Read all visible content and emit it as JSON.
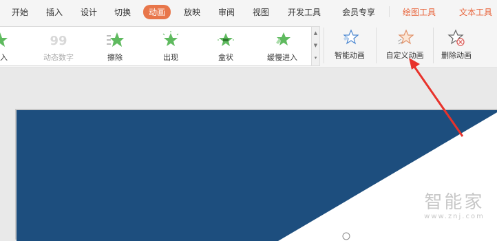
{
  "menu": {
    "tabs": [
      {
        "label": "开始"
      },
      {
        "label": "插入"
      },
      {
        "label": "设计"
      },
      {
        "label": "切换"
      },
      {
        "label": "动画"
      },
      {
        "label": "放映"
      },
      {
        "label": "审阅"
      },
      {
        "label": "视图"
      },
      {
        "label": "开发工具"
      },
      {
        "label": "会员专享"
      },
      {
        "label": "绘图工具"
      },
      {
        "label": "文本工具"
      }
    ],
    "active_tab": "动画"
  },
  "gallery": {
    "items": [
      {
        "label": "飞入",
        "icon": "fly-in-icon"
      },
      {
        "label": "动态数字",
        "icon": "dynamic-number-icon"
      },
      {
        "label": "擦除",
        "icon": "wipe-icon"
      },
      {
        "label": "出现",
        "icon": "appear-icon"
      },
      {
        "label": "盒状",
        "icon": "box-icon"
      },
      {
        "label": "缓慢进入",
        "icon": "slow-entry-icon"
      }
    ]
  },
  "ribbon": {
    "smart_animation": "智能动画",
    "custom_animation": "自定义动画",
    "delete_animation": "删除动画"
  },
  "watermark": {
    "main": "智能家",
    "sub": "www.znj.com"
  },
  "colors": {
    "accent": "#e8764a",
    "slide_blue": "#1d4e7e",
    "arrow": "#e8322b",
    "star_green": "#5fba5f"
  }
}
